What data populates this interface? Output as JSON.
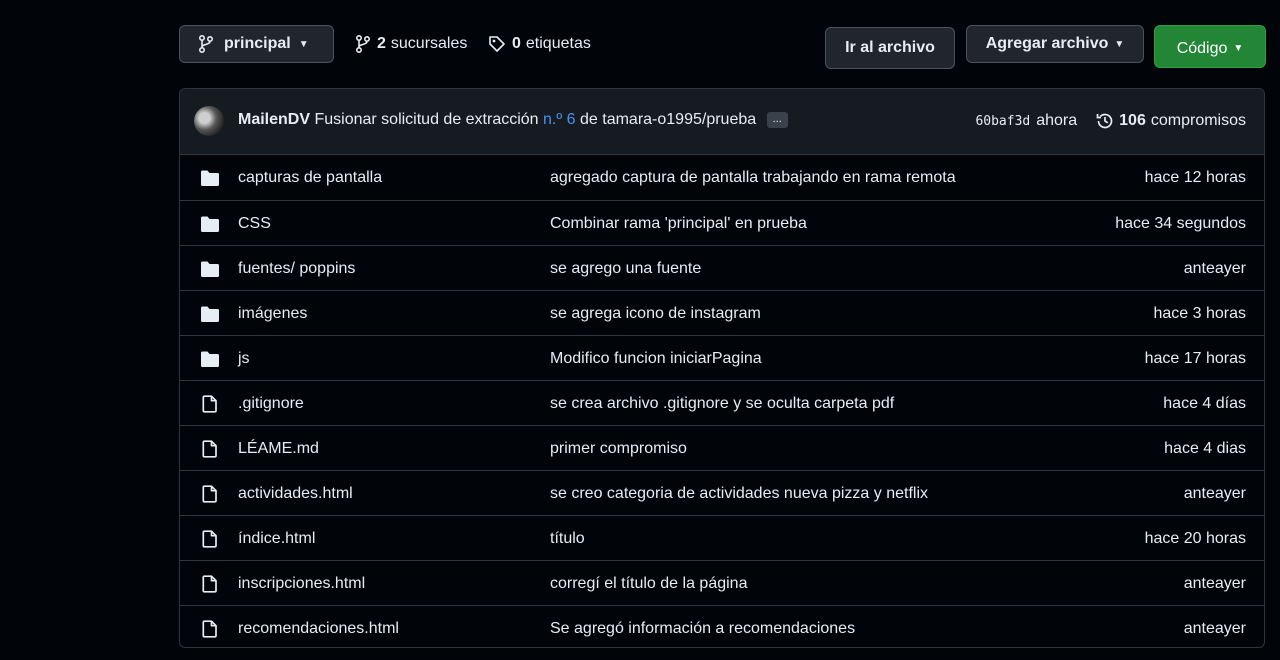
{
  "toolbar": {
    "branch_label": "principal",
    "branches_count": "2",
    "branches_label": "sucursales",
    "tags_count": "0",
    "tags_label": "etiquetas",
    "go_to_file": "Ir al archivo",
    "add_file": "Agregar archivo",
    "code": "Código"
  },
  "commit": {
    "author": "MailenDV",
    "message_pre": "Fusionar solicitud de extracción",
    "pr_link": "n.º 6",
    "message_post": "de tamara-o1995/prueba",
    "ellipsis": "...",
    "sha": "60baf3d",
    "when": "ahora",
    "count": "106",
    "count_label": "compromisos"
  },
  "files": [
    {
      "type": "folder",
      "name": "capturas de pantalla",
      "message": "agregado captura de pantalla trabajando en rama remota",
      "age": "hace 12 horas"
    },
    {
      "type": "folder",
      "name": "CSS",
      "message": "Combinar rama 'principal' en prueba",
      "age": "hace 34 segundos"
    },
    {
      "type": "folder",
      "name": "fuentes/ poppins",
      "message": "se agrego una fuente",
      "age": "anteayer"
    },
    {
      "type": "folder",
      "name": "imágenes",
      "message": "se agrega icono de instagram",
      "age": "hace 3 horas"
    },
    {
      "type": "folder",
      "name": "js",
      "message": "Modifico funcion iniciarPagina",
      "age": "hace 17 horas"
    },
    {
      "type": "file",
      "name": ".gitignore",
      "message": "se crea archivo .gitignore y se oculta carpeta pdf",
      "age": "hace 4 días"
    },
    {
      "type": "file",
      "name": "LÉAME.md",
      "message": "primer compromiso",
      "age": "hace 4 dias"
    },
    {
      "type": "file",
      "name": "actividades.html",
      "message": "se creo categoria de actividades nueva pizza y netflix",
      "age": "anteayer"
    },
    {
      "type": "file",
      "name": "índice.html",
      "message": "título",
      "age": "hace 20 horas"
    },
    {
      "type": "file",
      "name": "inscripciones.html",
      "message": "corregí el título de la página",
      "age": "anteayer"
    },
    {
      "type": "file",
      "name": "recomendaciones.html",
      "message": "Se agregó información a recomendaciones",
      "age": "anteayer"
    }
  ]
}
